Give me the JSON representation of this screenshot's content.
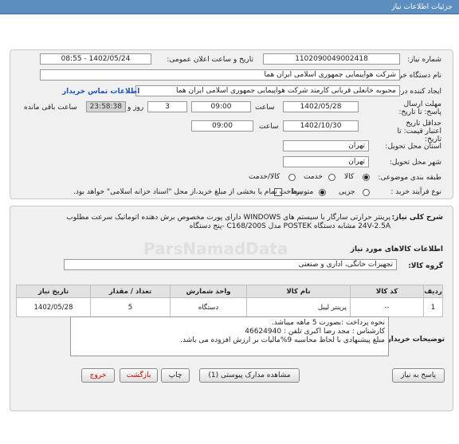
{
  "header": {
    "title": "جزئیات اطلاعات نیاز"
  },
  "need_number": {
    "label": "شماره نیاز:",
    "value": "1102090049002418"
  },
  "announce": {
    "label": "تاریخ و ساعت اعلان عمومی:",
    "value": "1402/05/24 - 08:55"
  },
  "buyer_org": {
    "label": "نام دستگاه خریدار:",
    "value": "شرکت هواپیمایی جمهوری اسلامی ایران هما"
  },
  "requester": {
    "label": "ایجاد کننده درخواست:",
    "value": "محبوبه خانعلی قربانی کارمند شرکت هواپیمایی جمهوری اسلامی ایران هما",
    "contact_link": "اطلاعات تماس خریدار"
  },
  "deadline_send": {
    "label": "مهلت ارسال پاسخ: تا تاریخ:",
    "date": "1402/05/28",
    "time_label": "ساعت",
    "time": "09:00",
    "days": "3",
    "days_label": "روز و",
    "remaining": "23:58:38",
    "remaining_label": "ساعت باقی مانده"
  },
  "deadline_price": {
    "label": "حداقل تاریخ اعتبار قیمت: تا تاریخ:",
    "date": "1402/10/30",
    "time_label": "ساعت",
    "time": "09:00"
  },
  "province": {
    "label": "استان محل تحویل:",
    "value": "تهران"
  },
  "city": {
    "label": "شهر محل تحویل:",
    "value": "تهران"
  },
  "category": {
    "label": "طبقه بندی موضوعی:",
    "options": [
      "کالا",
      "خدمت",
      "کالا/خدمت"
    ]
  },
  "purchase_type": {
    "label": "نوع فرآیند خرید :",
    "options": [
      "جزیی",
      "متوسط"
    ],
    "check_text": "پرداخت تمام یا بخشی از مبلغ خرید،از محل \"اسناد خزانه اسلامی\" خواهد بود."
  },
  "summary": {
    "label": "شرح کلی نیاز:",
    "lines": [
      "پرینتر حرارتی سارگار با سیستم های WINDOWS  دارای پورت مخصوص برش دهنده اتوماتیک سرعت مطلوب",
      "24V-2.5A  مشابه دستگاه POSTEK مدل C168/200S -پنج دستگاه"
    ]
  },
  "goods_info": {
    "title": "اطلاعات کالاهای مورد نیاز"
  },
  "goods_group": {
    "label": "گروه کالا:",
    "value": "تجهیزات خانگی، اداری و صنعتی"
  },
  "table": {
    "headers": [
      "ردیف",
      "کد کالا",
      "نام کالا",
      "واحد شمارش",
      "تعداد / مقدار",
      "تاریخ نیاز"
    ],
    "rows": [
      [
        "1",
        "--",
        "پرینتر لیبل",
        "دستگاه",
        "5",
        "1402/05/28"
      ]
    ]
  },
  "buyer_notes": {
    "label": "توضیحات خریدار:",
    "lines": [
      "نحوه  پرداخت :بصورت 5 ماهه میباشد.",
      "کارشناس : مجد رضا اکبری    تلفن  :  46624940",
      "مبلغ پیشنهادی با لحاظ محاسبه 9%مالیات بر ارزش افزوده می باشد."
    ]
  },
  "buttons": {
    "reply": "پاسخ به نیاز",
    "attachments": "مشاهده مدارک پیوستی (1)",
    "print": "چاپ",
    "back": "بازگشت",
    "exit": "خروج"
  },
  "watermark": {
    "text": "ParsNamadData"
  }
}
